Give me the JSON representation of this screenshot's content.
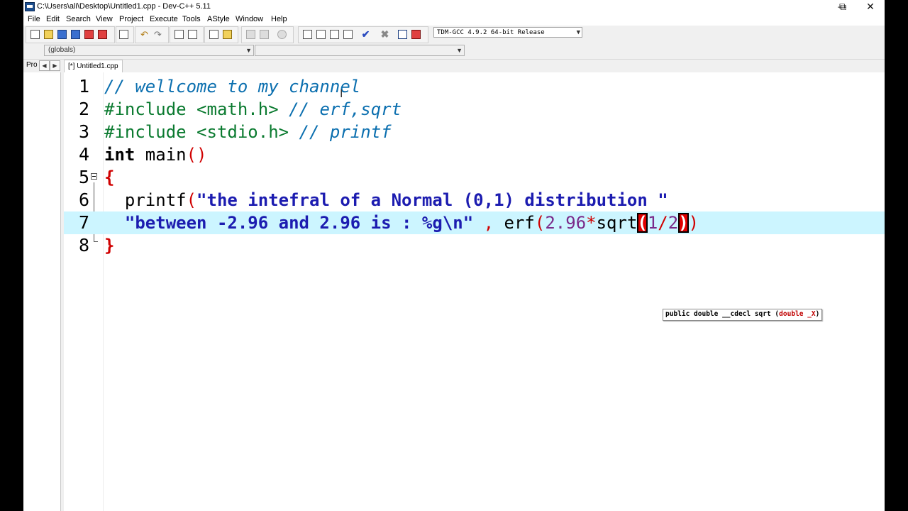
{
  "window": {
    "title": "C:\\Users\\ali\\Desktop\\Untitled1.cpp - Dev-C++ 5.11",
    "minimize": "—",
    "restore": "⧉",
    "close": "✕"
  },
  "menu": [
    "File",
    "Edit",
    "Search",
    "View",
    "Project",
    "Execute",
    "Tools",
    "AStyle",
    "Window",
    "Help"
  ],
  "toolbar": {
    "compiler": "TDM-GCC 4.9.2 64-bit Release"
  },
  "toolbar2": {
    "scope": "(globals)",
    "function": ""
  },
  "panels": {
    "left_tab": "Pro",
    "file_tab": "[*] Untitled1.cpp"
  },
  "editor": {
    "line_numbers": [
      "1",
      "2",
      "3",
      "4",
      "5",
      "6",
      "7",
      "8"
    ],
    "lines": [
      "// wellcome to my channel",
      "#include <math.h> // erf,sqrt",
      "#include <stdio.h> // printf",
      "int main()",
      "{",
      "  printf(\"the intefral of a Normal (0,1) distribution \"",
      "  \"between -2.96 and 2.96 is : %g\\n\" , erf(2.96*sqrt(1/2))",
      "}"
    ]
  },
  "tooltip": {
    "prefix": "public double",
    "signature": " __cdecl sqrt (",
    "param": "double _X",
    "suffix": ")"
  }
}
